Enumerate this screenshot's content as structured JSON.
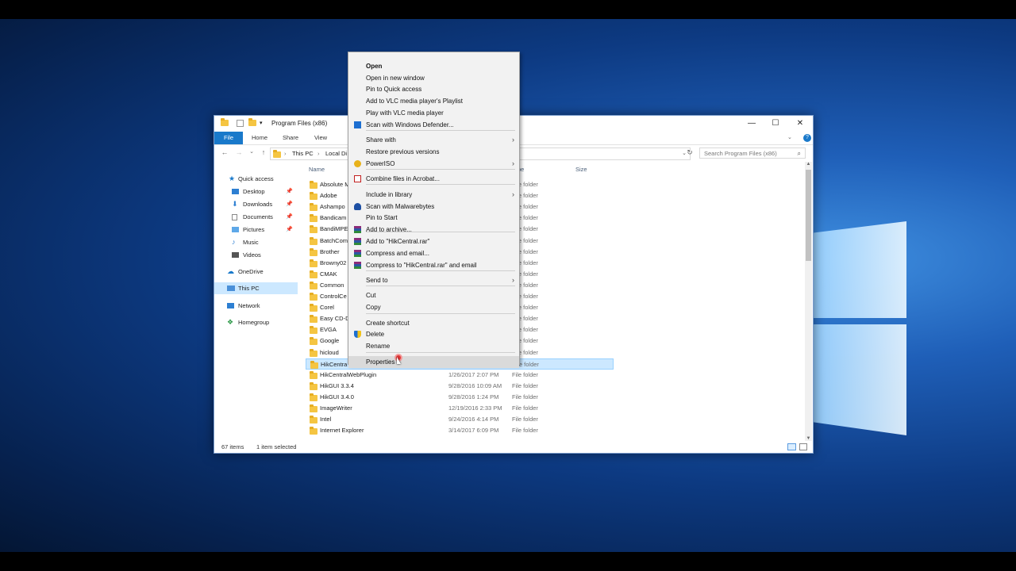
{
  "window": {
    "title": "Program Files (x86)",
    "minimize": "—",
    "maximize": "☐",
    "close": "✕"
  },
  "ribbon": {
    "tabs": [
      "File",
      "Home",
      "Share",
      "View"
    ]
  },
  "address": {
    "crumbs": [
      "This PC",
      "Local Di"
    ],
    "search_placeholder": "Search Program Files (x86)"
  },
  "nav": {
    "items": [
      {
        "label": "Quick access"
      },
      {
        "label": "Desktop"
      },
      {
        "label": "Downloads"
      },
      {
        "label": "Documents"
      },
      {
        "label": "Pictures"
      },
      {
        "label": "Music"
      },
      {
        "label": "Videos"
      },
      {
        "label": "OneDrive"
      },
      {
        "label": "This PC"
      },
      {
        "label": "Network"
      },
      {
        "label": "Homegroup"
      }
    ]
  },
  "columns": {
    "name": "Name",
    "type": "pe",
    "size": "Size"
  },
  "files": [
    {
      "name": "Absolute M",
      "date": "",
      "type": "File folder"
    },
    {
      "name": "Adobe",
      "date": "",
      "type": "File folder"
    },
    {
      "name": "Ashampo",
      "date": "",
      "type": "File folder"
    },
    {
      "name": "Bandicam",
      "date": "",
      "type": "File folder"
    },
    {
      "name": "BandiMPE",
      "date": "",
      "type": "File folder"
    },
    {
      "name": "BatchCom",
      "date": "",
      "type": "File folder"
    },
    {
      "name": "Brother",
      "date": "",
      "type": "File folder"
    },
    {
      "name": "Browny02",
      "date": "",
      "type": "File folder"
    },
    {
      "name": "CMAK",
      "date": "",
      "type": "File folder"
    },
    {
      "name": "Common",
      "date": "",
      "type": "File folder"
    },
    {
      "name": "ControlCe",
      "date": "",
      "type": "File folder"
    },
    {
      "name": "Corel",
      "date": "",
      "type": "File folder"
    },
    {
      "name": "Easy CD-D",
      "date": "",
      "type": "File folder"
    },
    {
      "name": "EVGA",
      "date": "",
      "type": "File folder"
    },
    {
      "name": "Google",
      "date": "",
      "type": "File folder"
    },
    {
      "name": "hicloud",
      "date": "",
      "type": "File folder"
    },
    {
      "name": "HikCentra",
      "date": "",
      "type": "File folder"
    },
    {
      "name": "HikCentralWebPlugin",
      "date": "1/26/2017 2:07 PM",
      "type": "File folder"
    },
    {
      "name": "HikGUI 3.3.4",
      "date": "9/28/2016 10:09 AM",
      "type": "File folder"
    },
    {
      "name": "HikGUI 3.4.0",
      "date": "9/28/2016 1:24 PM",
      "type": "File folder"
    },
    {
      "name": "ImageWriter",
      "date": "12/19/2016 2:33 PM",
      "type": "File folder"
    },
    {
      "name": "Intel",
      "date": "9/24/2016 4:14 PM",
      "type": "File folder"
    },
    {
      "name": "Internet Explorer",
      "date": "3/14/2017 6:09 PM",
      "type": "File folder"
    }
  ],
  "status": {
    "count": "67 items",
    "selected": "1 item selected"
  },
  "menu": {
    "items": [
      {
        "label": "Open"
      },
      {
        "label": "Open in new window"
      },
      {
        "label": "Pin to Quick access"
      },
      {
        "label": "Add to VLC media player's Playlist"
      },
      {
        "label": "Play with VLC media player"
      },
      {
        "label": "Scan with Windows Defender..."
      },
      {
        "label": "Share with"
      },
      {
        "label": "Restore previous versions"
      },
      {
        "label": "PowerISO"
      },
      {
        "label": "Combine files in Acrobat..."
      },
      {
        "label": "Include in library"
      },
      {
        "label": "Scan with Malwarebytes"
      },
      {
        "label": "Pin to Start"
      },
      {
        "label": "Add to archive..."
      },
      {
        "label": "Add to \"HikCentral.rar\""
      },
      {
        "label": "Compress and email..."
      },
      {
        "label": "Compress to \"HikCentral.rar\" and email"
      },
      {
        "label": "Send to"
      },
      {
        "label": "Cut"
      },
      {
        "label": "Copy"
      },
      {
        "label": "Create shortcut"
      },
      {
        "label": "Delete"
      },
      {
        "label": "Rename"
      },
      {
        "label": "Properties"
      }
    ]
  },
  "colors": {
    "accent": "#1979ca",
    "selection": "#cce8ff"
  }
}
